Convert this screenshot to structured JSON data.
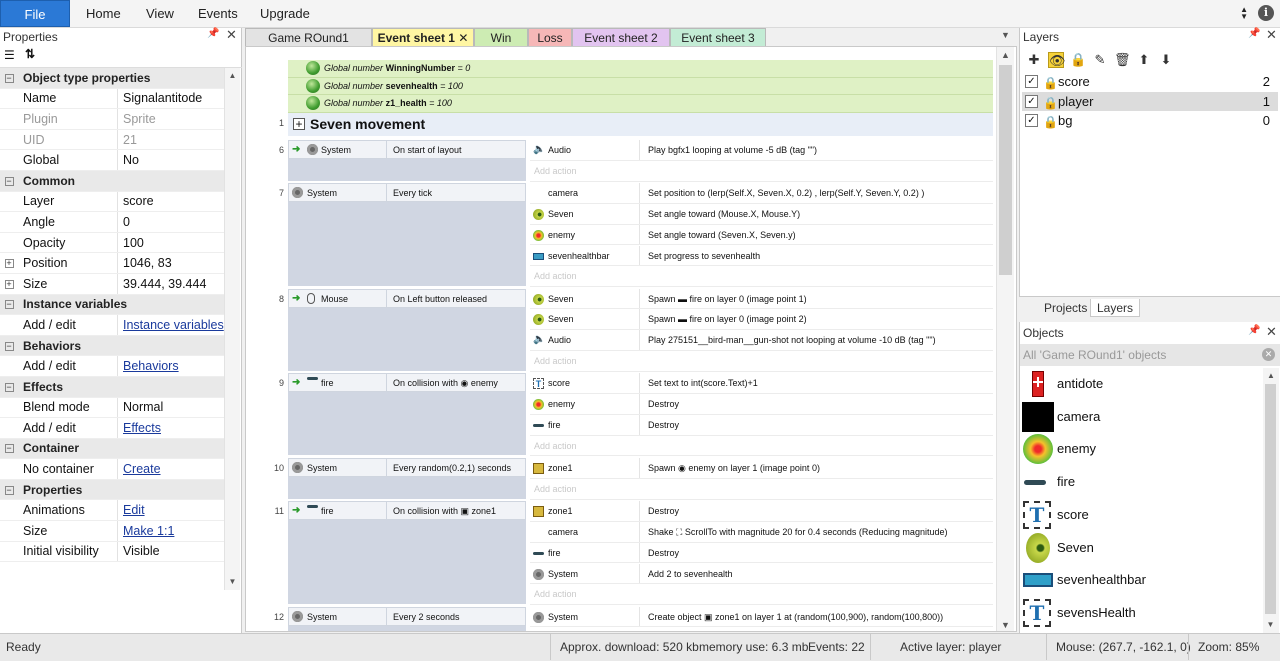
{
  "ribbon": {
    "file": "File",
    "tabs": [
      "Home",
      "View",
      "Events",
      "Upgrade"
    ],
    "info": "i"
  },
  "properties": {
    "title": "Properties",
    "rows": [
      {
        "type": "section",
        "name": "Object type properties"
      },
      {
        "name": "Name",
        "value": "Signalantitode"
      },
      {
        "name": "Plugin",
        "value": "Sprite",
        "dim": true
      },
      {
        "name": "UID",
        "value": "21",
        "dim": true
      },
      {
        "name": "Global",
        "value": "No"
      },
      {
        "type": "section",
        "name": "Common"
      },
      {
        "name": "Layer",
        "value": "score"
      },
      {
        "name": "Angle",
        "value": "0"
      },
      {
        "name": "Opacity",
        "value": "100"
      },
      {
        "name": "Position",
        "value": "1046, 83",
        "expand": true
      },
      {
        "name": "Size",
        "value": "39.444, 39.444",
        "expand": true
      },
      {
        "type": "section",
        "name": "Instance variables"
      },
      {
        "name": "Add / edit",
        "value": "Instance variables",
        "link": true
      },
      {
        "type": "section",
        "name": "Behaviors"
      },
      {
        "name": "Add / edit",
        "value": "Behaviors",
        "link": true
      },
      {
        "type": "section",
        "name": "Effects"
      },
      {
        "name": "Blend mode",
        "value": "Normal"
      },
      {
        "name": "Add / edit",
        "value": "Effects",
        "link": true
      },
      {
        "type": "section",
        "name": "Container"
      },
      {
        "name": "No container",
        "value": "Create",
        "link": true
      },
      {
        "type": "section",
        "name": "Properties"
      },
      {
        "name": "Animations",
        "value": "Edit",
        "link": true
      },
      {
        "name": "Size",
        "value": "Make 1:1",
        "link": true
      },
      {
        "name": "Initial visibility",
        "value": "Visible"
      }
    ]
  },
  "tabs": [
    {
      "label": "Game ROund1",
      "color": "#e3e3e3"
    },
    {
      "label": "Event sheet 1",
      "color": "#fff6a3",
      "active": true
    },
    {
      "label": "Win",
      "color": "#cdecb3"
    },
    {
      "label": "Loss",
      "color": "#f6b7b7"
    },
    {
      "label": "Event sheet 2",
      "color": "#e2c4f0"
    },
    {
      "label": "Event sheet 3",
      "color": "#c3ecd5"
    }
  ],
  "globals": [
    {
      "prefix": "Global number",
      "name": "WinningNumber",
      "value": "= 0"
    },
    {
      "prefix": "Global number",
      "name": "sevenhealth",
      "value": "= 100"
    },
    {
      "prefix": "Global number",
      "name": "z1_health",
      "value": "= 100"
    }
  ],
  "group": {
    "number": "1",
    "title": "Seven movement"
  },
  "events": [
    {
      "num": "6",
      "trigger": true,
      "cond_obj": "System",
      "cond_icon": "gear",
      "cond": "On start of layout",
      "actions": [
        {
          "obj": "Audio",
          "icon": "spk",
          "text": "Play bgfx1 looping at volume -5 dB (tag \"\")"
        }
      ]
    },
    {
      "num": "7",
      "trigger": false,
      "cond_obj": "System",
      "cond_icon": "gear",
      "cond": "Every tick",
      "actions": [
        {
          "obj": "camera",
          "icon": "none",
          "text": "Set position to (lerp(Self.X, Seven.X, 0.2) , lerp(Self.Y, Seven.Y, 0.2) )"
        },
        {
          "obj": "Seven",
          "icon": "seven",
          "text": "Set angle toward (Mouse.X, Mouse.Y)"
        },
        {
          "obj": "enemy",
          "icon": "enemy",
          "text": "Set angle toward (Seven.X, Seven.y)"
        },
        {
          "obj": "sevenhealthbar",
          "icon": "bar",
          "text": "Set progress to sevenhealth"
        }
      ]
    },
    {
      "num": "8",
      "trigger": true,
      "cond_obj": "Mouse",
      "cond_icon": "mouse",
      "cond": "On Left button released",
      "actions": [
        {
          "obj": "Seven",
          "icon": "seven",
          "text": "Spawn ▬ fire on layer 0 (image point 1)"
        },
        {
          "obj": "Seven",
          "icon": "seven",
          "text": "Spawn ▬ fire on layer 0 (image point 2)"
        },
        {
          "obj": "Audio",
          "icon": "spk",
          "text": "Play 275151__bird-man__gun-shot not looping at volume -10 dB (tag \"\")"
        }
      ]
    },
    {
      "num": "9",
      "trigger": true,
      "cond_obj": "fire",
      "cond_icon": "fire",
      "cond": "On collision with ◉ enemy",
      "actions": [
        {
          "obj": "score",
          "icon": "txt",
          "text": "Set text to int(score.Text)+1"
        },
        {
          "obj": "enemy",
          "icon": "enemy",
          "text": "Destroy"
        },
        {
          "obj": "fire",
          "icon": "fire",
          "text": "Destroy"
        }
      ]
    },
    {
      "num": "10",
      "trigger": false,
      "cond_obj": "System",
      "cond_icon": "gear",
      "cond": "Every random(0.2,1) seconds",
      "actions": [
        {
          "obj": "zone1",
          "icon": "zone",
          "text": "Spawn ◉ enemy on layer 1 (image point 0)"
        }
      ]
    },
    {
      "num": "11",
      "trigger": true,
      "cond_obj": "fire",
      "cond_icon": "fire",
      "cond": "On collision with ▣ zone1",
      "actions": [
        {
          "obj": "zone1",
          "icon": "zone",
          "text": "Destroy"
        },
        {
          "obj": "camera",
          "icon": "none",
          "text": "Shake ⛶ ScrollTo with magnitude 20 for 0.4 seconds (Reducing magnitude)"
        },
        {
          "obj": "fire",
          "icon": "fire",
          "text": "Destroy"
        },
        {
          "obj": "System",
          "icon": "gear",
          "text": "Add 2 to sevenhealth"
        }
      ]
    },
    {
      "num": "12",
      "trigger": false,
      "cond_obj": "System",
      "cond_icon": "gear",
      "cond": "Every 2 seconds",
      "actions": [
        {
          "obj": "System",
          "icon": "gear",
          "text": "Create object ▣ zone1 on layer 1 at (random(100,900), random(100,800))"
        }
      ]
    }
  ],
  "add_action": "Add action",
  "layers": {
    "title": "Layers",
    "items": [
      {
        "name": "score",
        "num": "2",
        "locked": false
      },
      {
        "name": "player",
        "num": "1",
        "locked": false,
        "selected": true
      },
      {
        "name": "bg",
        "num": "0",
        "locked": true
      }
    ],
    "tabs": [
      "Projects",
      "Layers"
    ]
  },
  "objects": {
    "title": "Objects",
    "filter": "All 'Game ROund1' objects",
    "items": [
      "antidote",
      "camera",
      "enemy",
      "fire",
      "score",
      "Seven",
      "sevenhealthbar",
      "sevensHealth"
    ]
  },
  "status": {
    "ready": "Ready",
    "download": "Approx. download: 520 kb",
    "memory": "memory use: 6.3 mb",
    "events": "Events: 22",
    "layer": "Active layer: player",
    "mouse": "Mouse: (267.7, -162.1, 0)",
    "zoom": "Zoom: 85%"
  }
}
